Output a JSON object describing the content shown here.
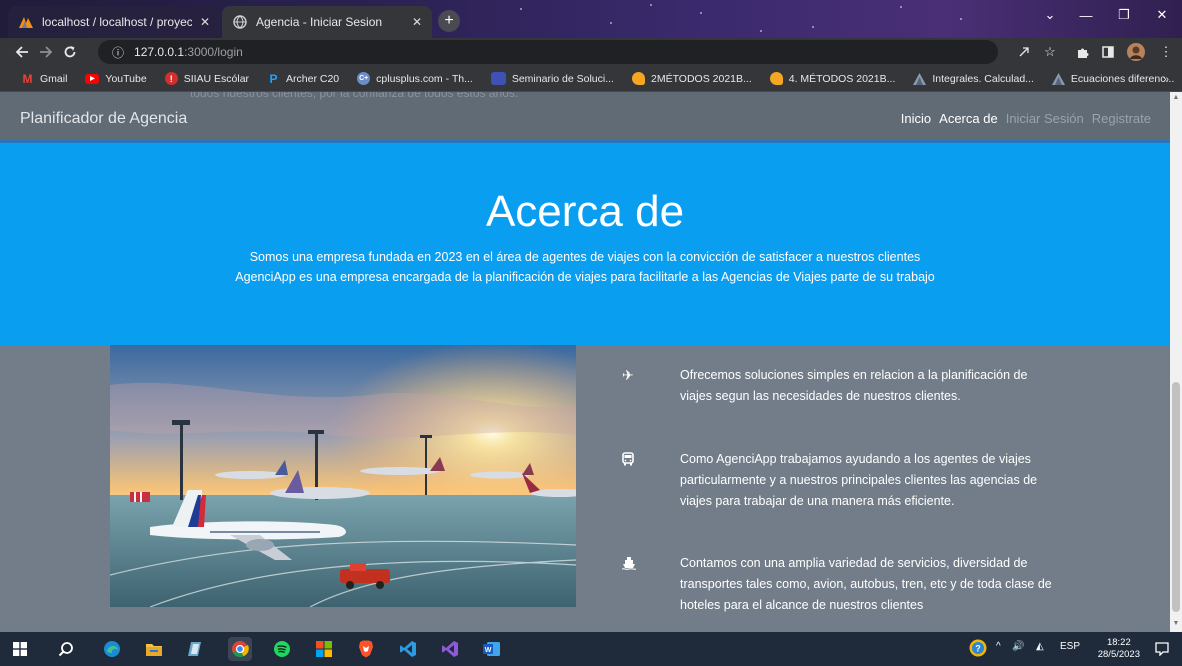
{
  "browser": {
    "tabs": [
      {
        "title": "localhost / localhost / proyecto /",
        "icon": "phpmyadmin-icon",
        "close": "✕",
        "active": false
      },
      {
        "title": "Agencia - Iniciar Sesion",
        "icon": "globe-icon",
        "close": "✕",
        "active": true
      }
    ],
    "new_tab": "+",
    "url_host": "127.0.0.1",
    "url_path": ":3000/login",
    "url_info": "ⓘ",
    "window_controls": {
      "minimize": "—",
      "maximize": "❐",
      "close": "✕",
      "dropdown": "⌄"
    },
    "bookmarks": [
      {
        "label": "Gmail",
        "icon": "gmail-icon",
        "color": "#ea4335"
      },
      {
        "label": "YouTube",
        "icon": "youtube-icon",
        "color": "#ff0000"
      },
      {
        "label": "SIIAU Escólar",
        "icon": "siiau-icon",
        "color": "#d32f2f"
      },
      {
        "label": "Archer C20",
        "icon": "tplink-icon",
        "color": "#1aa3ff"
      },
      {
        "label": "cplusplus.com - Th...",
        "icon": "cplusplus-icon",
        "color": "#6b8cc4"
      },
      {
        "label": "Seminario de Soluci...",
        "icon": "classroom-icon",
        "color": "#3f51b5"
      },
      {
        "label": "2MÉTODOS 2021B...",
        "icon": "notebook-icon",
        "color": "#f5a623"
      },
      {
        "label": "4. MÉTODOS 2021B...",
        "icon": "notebook-icon",
        "color": "#f5a623"
      },
      {
        "label": "Integrales. Calculad...",
        "icon": "integral-icon",
        "color": "#6e7d91"
      },
      {
        "label": "Ecuaciones diferenc...",
        "icon": "integral-icon",
        "color": "#6e7d91"
      }
    ],
    "bookmarks_more": "»"
  },
  "page": {
    "ghost_text": "todos nuestros clientes, por la confianza de todos estos años.",
    "brand": "Planificador de Agencia",
    "nav": [
      {
        "label": "Inicio",
        "color": "#ffffff"
      },
      {
        "label": "Acerca de",
        "color": "#ffffff"
      },
      {
        "label": "Iniciar Sesión",
        "color": "#9aa3ac"
      },
      {
        "label": "Registrate",
        "color": "#9aa3ac"
      }
    ],
    "hero": {
      "title": "Acerca de",
      "line1": "Somos una empresa fundada en 2023 en el área de agentes de viajes con la convicción de satisfacer a nuestros clientes",
      "line2": "AgenciApp es una empresa encargada de la planificación de viajes para facilitarle a las Agencias de Viajes parte de su trabajo"
    },
    "features": [
      {
        "icon": "airplane-icon",
        "glyph": "✈",
        "text": "Ofrecemos soluciones simples en relacion a la planificación de viajes segun las necesidades de nuestros clientes."
      },
      {
        "icon": "bus-icon",
        "glyph": "🚍",
        "text": "Como AgenciApp trabajamos ayudando a los agentes de viajes particularmente y a nuestros principales clientes las agencias de viajes para trabajar de una manera más eficiente."
      },
      {
        "icon": "ship-icon",
        "glyph": "⛴",
        "text": "Contamos con una amplia variedad de servicios, diversidad de transportes tales como, avion, autobus, tren, etc y de toda clase de hoteles para el alcance de nuestros clientes"
      }
    ],
    "colors": {
      "hero": "#0a9ef1",
      "body": "#727d89",
      "navbar": "#606b76"
    }
  },
  "taskbar": {
    "apps": [
      "windows-start-icon",
      "search-icon",
      "edge-icon",
      "file-explorer-icon",
      "notepad-icon",
      "chrome-icon",
      "spotify-icon",
      "microsoft-store-icon",
      "brave-icon",
      "vscode-icon",
      "visual-studio-icon",
      "word-icon"
    ],
    "language": "ESP",
    "time": "18:22",
    "date": "28/5/2023"
  }
}
